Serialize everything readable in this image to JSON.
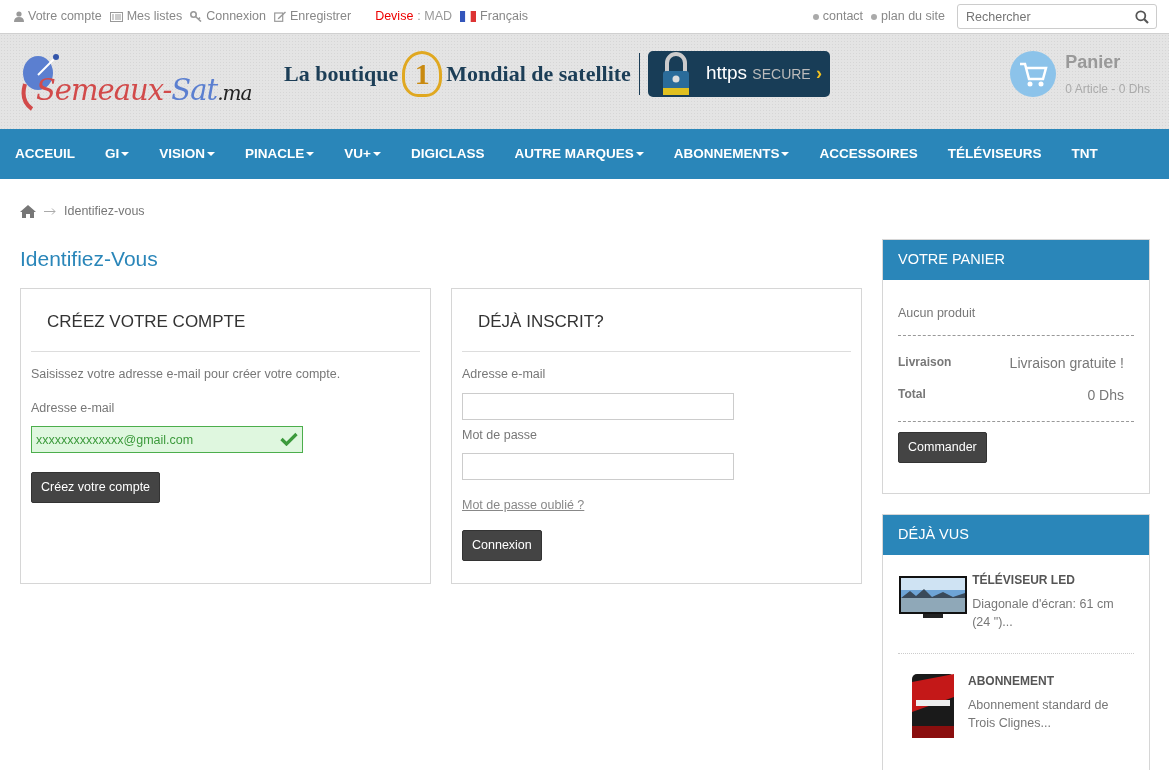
{
  "top_links": [
    {
      "label": "Votre compte"
    },
    {
      "label": "Mes listes"
    },
    {
      "label": "Connexion"
    },
    {
      "label": "Enregistrer"
    }
  ],
  "currency": {
    "label": "Devise",
    "value": ": MAD"
  },
  "language": "Français",
  "secondary_links": [
    "contact",
    "plan du site"
  ],
  "search": {
    "placeholder": "Rechercher"
  },
  "logo": {
    "part_1": "Semeaux-",
    "part_2": "Sat",
    "part_3": ".ma"
  },
  "banner": {
    "text_before": "La boutique",
    "medal": "1",
    "text_after": "Mondial de satellite",
    "secure_main": "https",
    "secure_sub": "SECURE",
    "secure_arrow": "›"
  },
  "cart": {
    "title": "Panier",
    "summary": "0 Article - 0 Dhs"
  },
  "nav": [
    {
      "label": "ACCEUIL",
      "has_menu": false
    },
    {
      "label": "GI",
      "has_menu": true
    },
    {
      "label": "VISION",
      "has_menu": true
    },
    {
      "label": "PINACLE",
      "has_menu": true
    },
    {
      "label": "VU+",
      "has_menu": true
    },
    {
      "label": "DIGICLASS",
      "has_menu": false
    },
    {
      "label": "AUTRE MARQUES",
      "has_menu": true
    },
    {
      "label": "ABONNEMENTS",
      "has_menu": true
    },
    {
      "label": "ACCESSOIRES",
      "has_menu": false
    },
    {
      "label": "TÉLÉVISEURS",
      "has_menu": false
    },
    {
      "label": "TNT",
      "has_menu": false
    }
  ],
  "breadcrumb": {
    "current": "Identifiez-vous"
  },
  "page_title": "Identifiez-Vous",
  "create_account": {
    "title": "CRÉEZ VOTRE COMPTE",
    "intro": "Saisissez votre adresse e-mail pour créer votre compte.",
    "email_label": "Adresse e-mail",
    "email_value": "xxxxxxxxxxxxxx@gmail.com",
    "email_valid": true,
    "button": "Créez votre compte"
  },
  "login": {
    "title": "DÉJÀ INSCRIT?",
    "email_label": "Adresse e-mail",
    "password_label": "Mot de passe",
    "forgot_link": "Mot de passe oublié ?",
    "button": "Connexion"
  },
  "cart_block": {
    "title": "VOTRE PANIER",
    "empty_text": "Aucun produit",
    "rows": [
      {
        "label": "Livraison",
        "value": "Livraison gratuite !"
      },
      {
        "label": "Total",
        "value": "0 Dhs"
      }
    ],
    "button": "Commander"
  },
  "viewed": {
    "title": "DÉJÀ VUS",
    "items": [
      {
        "kind": "tv",
        "name": "TÉLÉVISEUR LED",
        "description": "Diagonale d'écran: 61 cm (24 \")..."
      },
      {
        "kind": "box",
        "name": "ABONNEMENT",
        "description": "Abonnement standard de Trois Clignes..."
      }
    ]
  }
}
